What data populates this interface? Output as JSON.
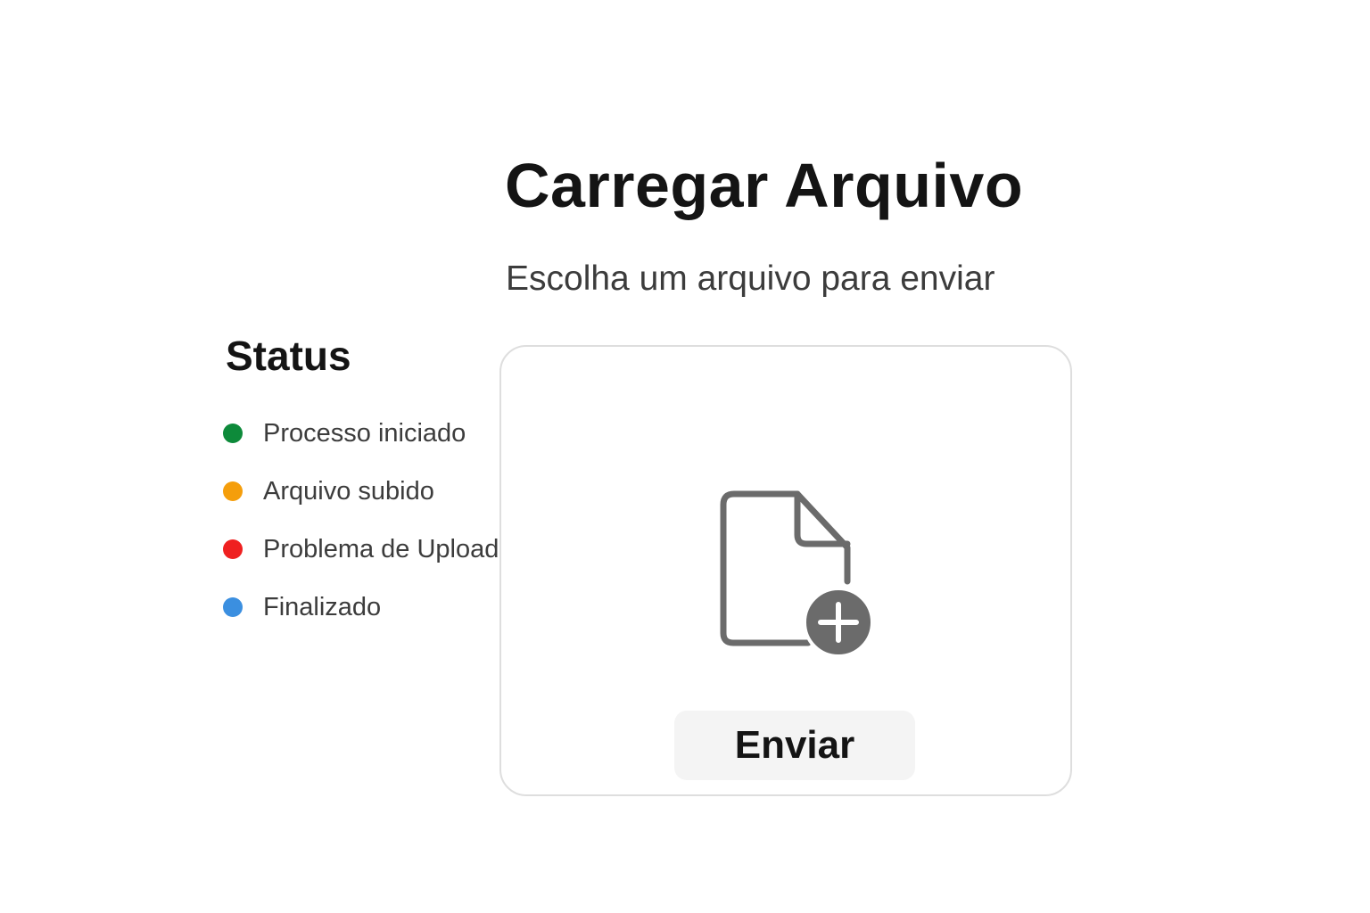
{
  "header": {
    "title": "Carregar Arquivo",
    "subtitle": "Escolha um arquivo para enviar"
  },
  "status": {
    "heading": "Status",
    "items": [
      {
        "label": "Processo iniciado",
        "color": "#0d8a3a"
      },
      {
        "label": "Arquivo subido",
        "color": "#f59e0b"
      },
      {
        "label": "Problema de Upload",
        "color": "#ef2020"
      },
      {
        "label": "Finalizado",
        "color": "#3b8fe0"
      }
    ]
  },
  "upload": {
    "icon": "file-add-icon",
    "icon_color": "#6b6b6b",
    "button_label": "Enviar"
  }
}
